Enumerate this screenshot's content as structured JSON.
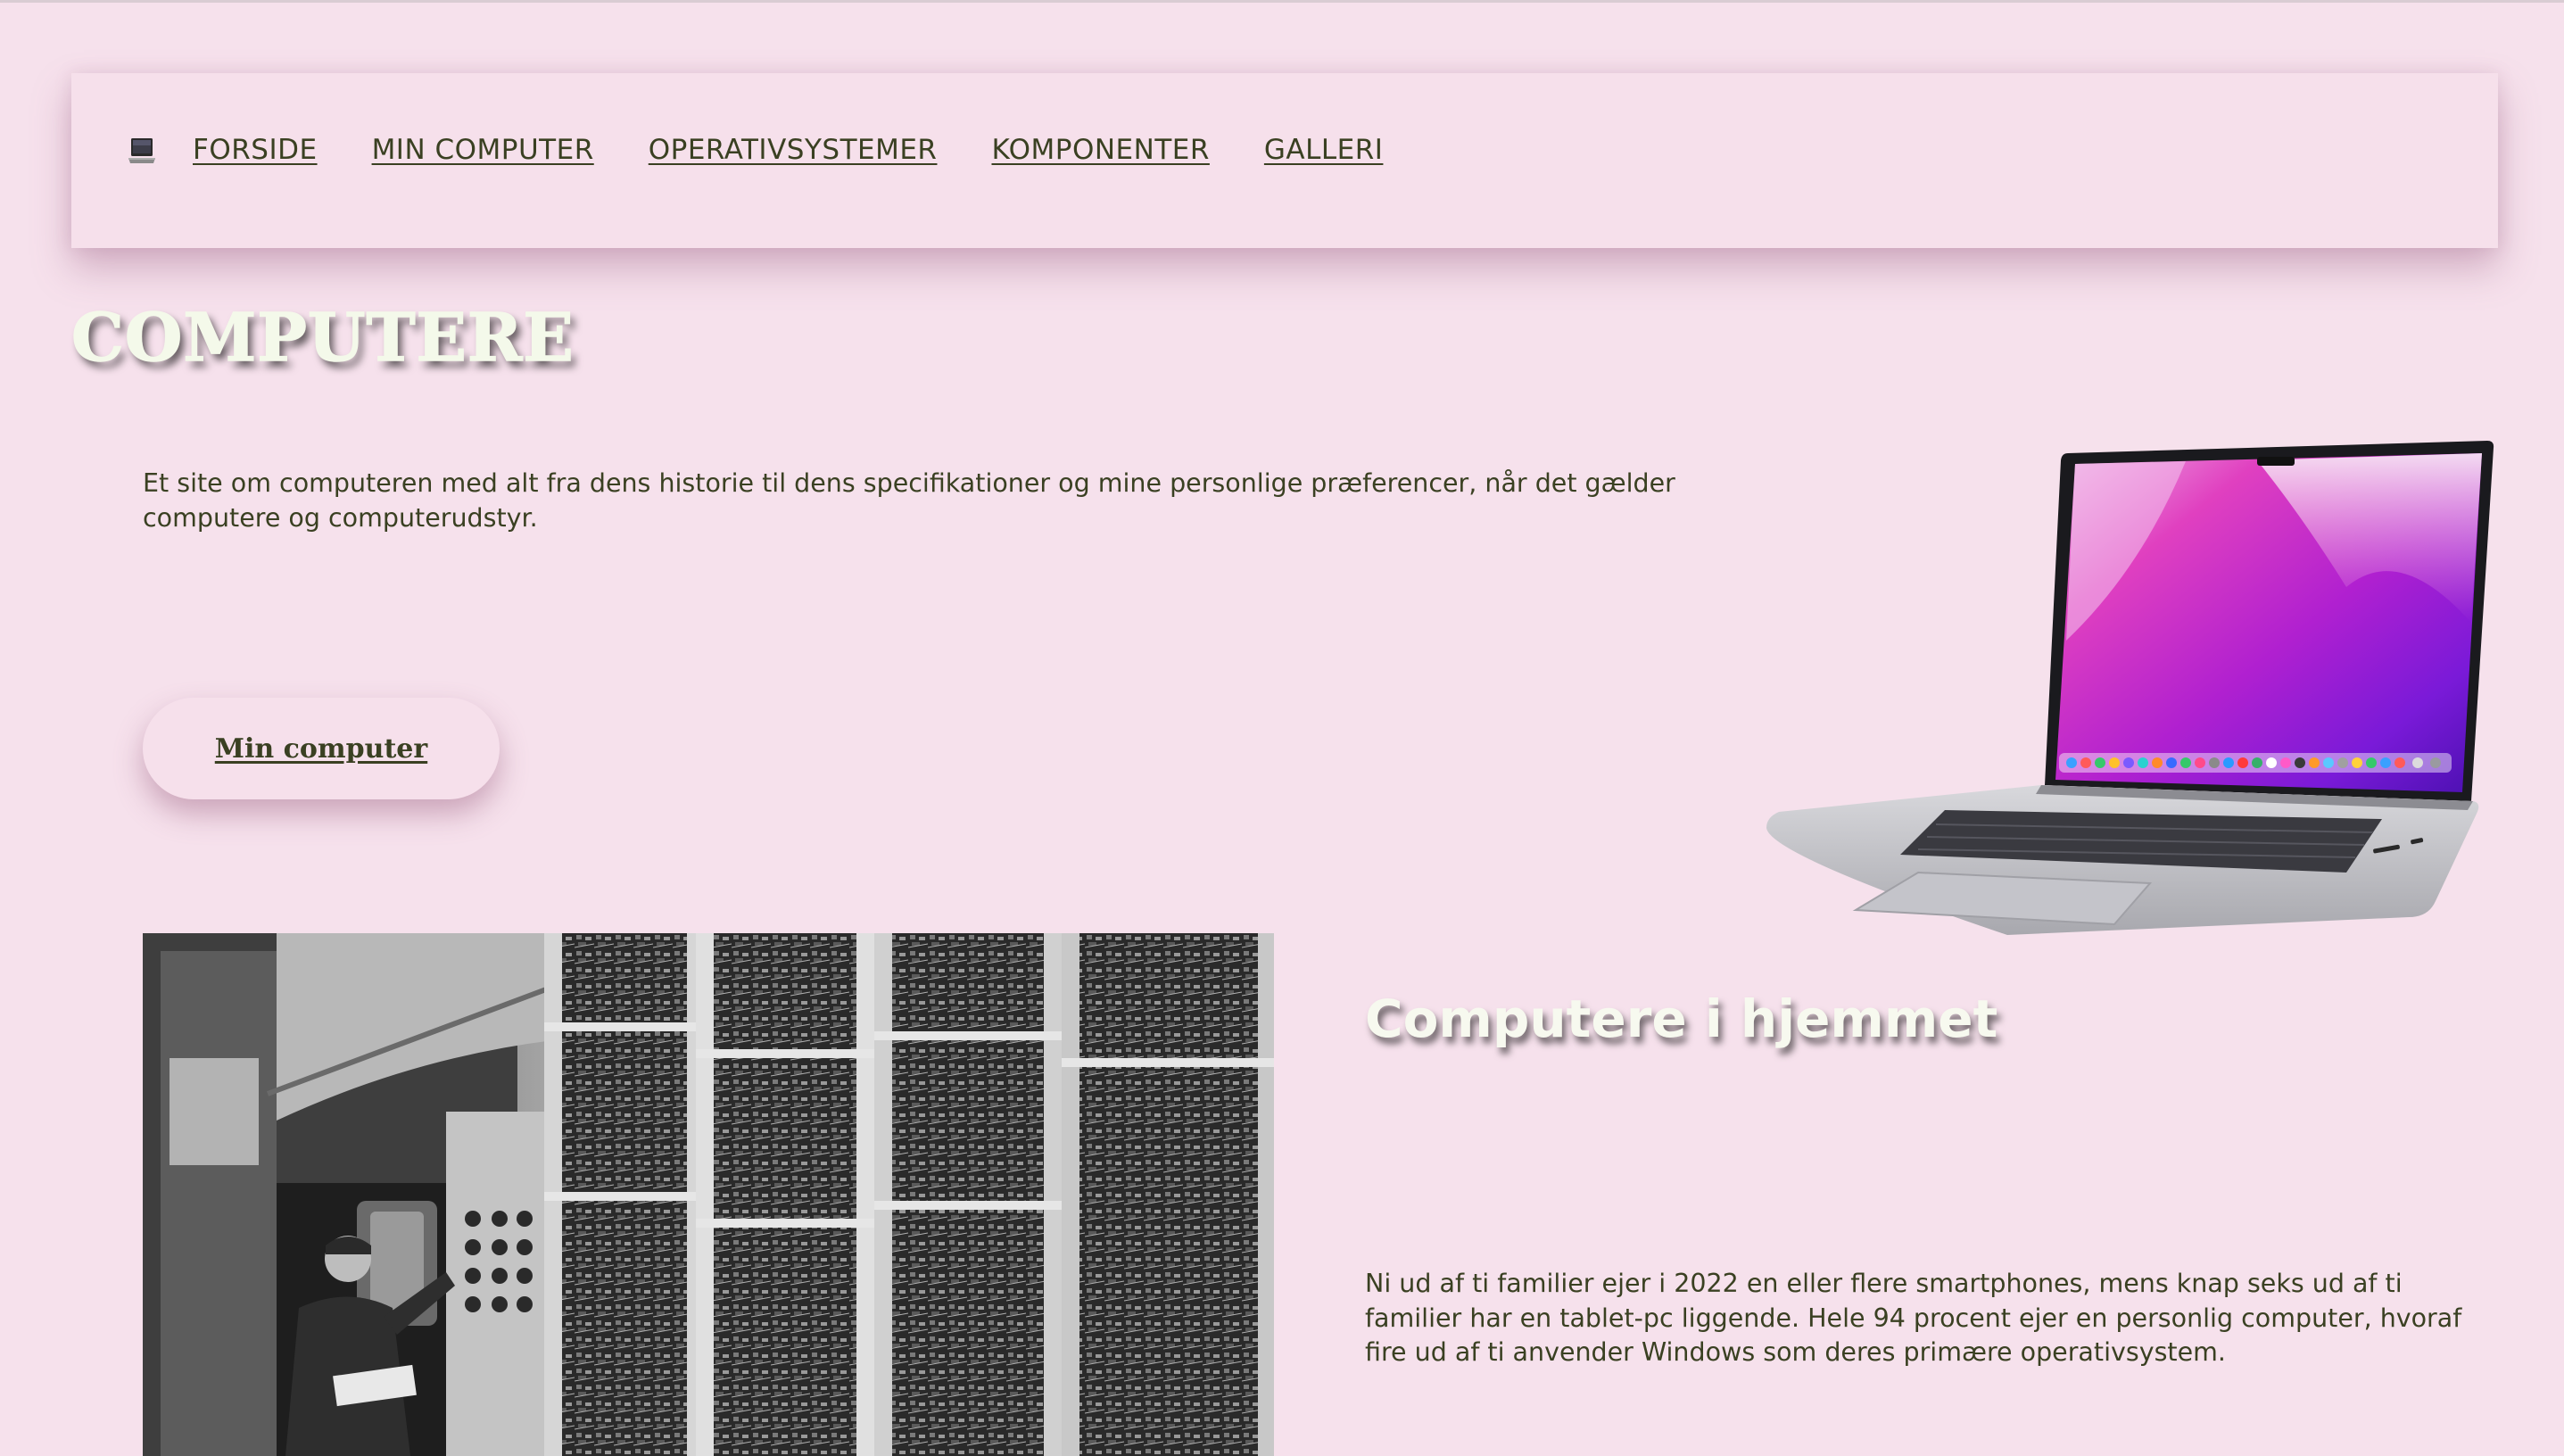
{
  "nav": {
    "logo_icon": "laptop-icon",
    "items": [
      {
        "label": "FORSIDE"
      },
      {
        "label": "MIN COMPUTER"
      },
      {
        "label": "OPERATIVSYSTEMER"
      },
      {
        "label": "KOMPONENTER"
      },
      {
        "label": "GALLERI"
      }
    ]
  },
  "hero": {
    "title": "COMPUTERE",
    "intro": "Et site om computeren med alt fra dens historie til dens specifikationer og mine personlige præferencer, når det gælder computere og computerudstyr.",
    "button_label": "Min computer",
    "image_icon": "laptop-photo"
  },
  "home_section": {
    "image_icon": "vintage-computer-photo",
    "title": "Computere i hjemmet",
    "text": "Ni ud af ti familier ejer i 2022 en eller flere smartphones, mens knap seks ud af ti familier har en tablet-pc liggende. Hele 94 procent ejer en personlig computer, hvoraf fire ud af ti anvender Windows som deres primære operativsystem."
  },
  "colors": {
    "background": "#f6e1ec",
    "text": "#3a4022",
    "heading": "#f4f9ea"
  }
}
